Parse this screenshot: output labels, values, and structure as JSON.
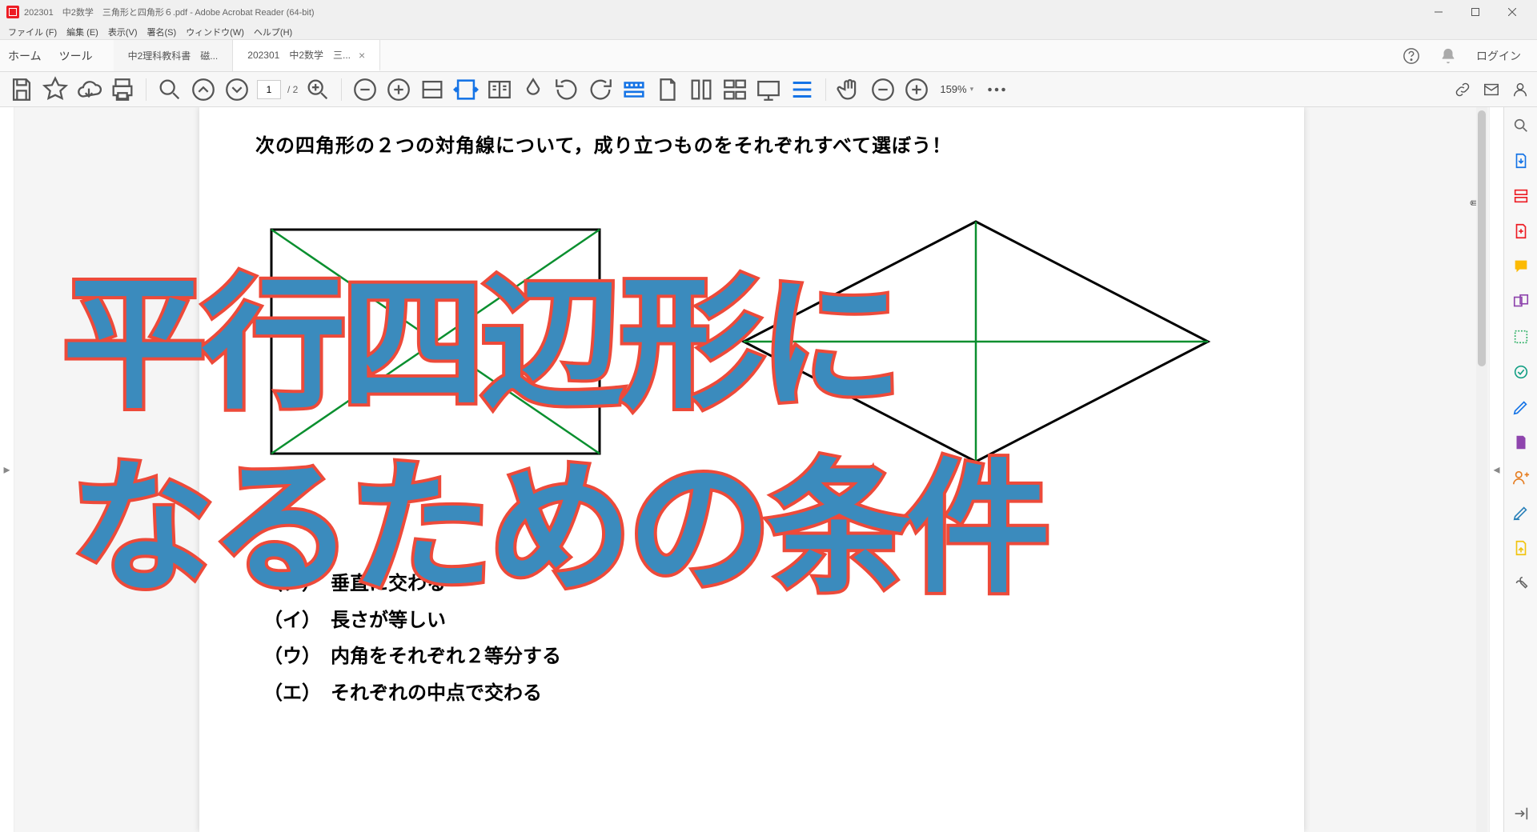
{
  "title": "202301　中2数学　三角形と四角形６.pdf - Adobe Acrobat Reader (64-bit)",
  "menu": {
    "file": "ファイル (F)",
    "edit": "編集 (E)",
    "view": "表示(V)",
    "sign": "署名(S)",
    "window": "ウィンドウ(W)",
    "help": "ヘルプ(H)"
  },
  "tabbar": {
    "home": "ホーム",
    "tools": "ツール",
    "tab1": "中2理科教科書　磁...",
    "tab2": "202301　中2数学　三...",
    "login": "ログイン"
  },
  "toolbar": {
    "page_current": "1",
    "page_total": "/ 2",
    "zoom": "159%"
  },
  "document": {
    "question": "次の四角形の２つの対角線について，成り立つものをそれぞれすべて選ぼう！",
    "shape1": "長方形",
    "shape2": "ひし形",
    "options": {
      "a": "（ア）　垂直に交わる",
      "b": "（イ）　長さが等しい",
      "c": "（ウ）　内角をそれぞれ２等分する",
      "d": "（エ）　それぞれの中点で交わる"
    },
    "overlay_line1": "平行四辺形に",
    "overlay_line2": "なるための条件"
  }
}
